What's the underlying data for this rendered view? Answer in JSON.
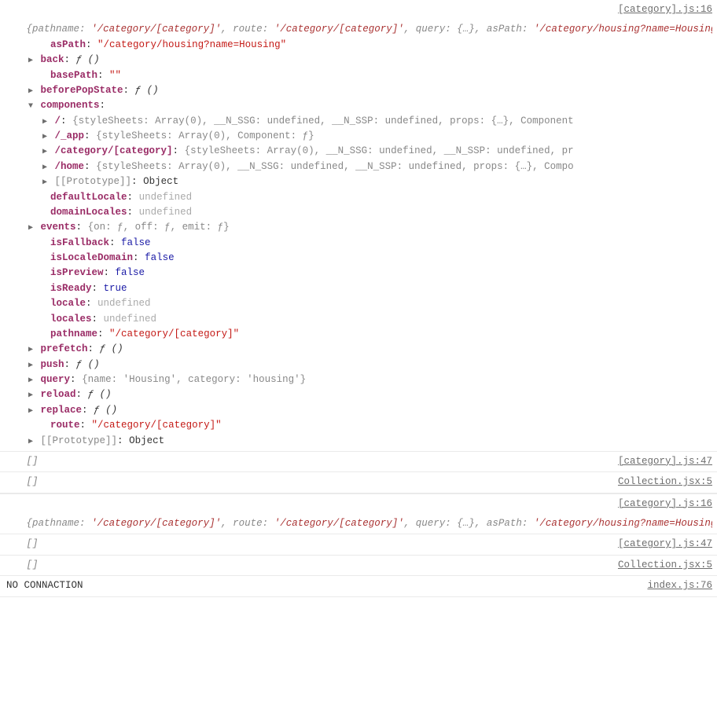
{
  "sources": {
    "cat16": "[category].js:16",
    "cat47": "[category].js:47",
    "coll5": "Collection.jsx:5",
    "idx76": "index.js:76"
  },
  "icons": {
    "info": "i"
  },
  "glyphs": {
    "emptyArr": "[]",
    "braceOpen": "{",
    "braceEllipsis": "{…}",
    "ellipsis": "…",
    "braceClose": "}",
    "colon": ":",
    "comma": ","
  },
  "preview": {
    "labels": {
      "pathname": "pathname",
      "route": "route",
      "query": "query",
      "asPath": "asPath",
      "components": "components"
    },
    "pathname": "'/category/[category]'",
    "route": "'/category/[category]'",
    "asPath": "'/category/housing?name=Housing'"
  },
  "router": {
    "asPath": {
      "k": "asPath",
      "v": "\"/category/housing?name=Housing\""
    },
    "back": {
      "k": "back",
      "v": "ƒ ()"
    },
    "basePath": {
      "k": "basePath",
      "v": "\"\""
    },
    "beforePopState": {
      "k": "beforePopState",
      "v": "ƒ ()"
    },
    "componentsKey": "components",
    "components": {
      "slash": {
        "k": "/",
        "rest": "{styleSheets: Array(0), __N_SSG: undefined, __N_SSP: undefined, props: {…}, Component"
      },
      "app": {
        "k": "/_app",
        "rest": "{styleSheets: Array(0), Component: ƒ}"
      },
      "cat": {
        "k": "/category/[category]",
        "rest": "{styleSheets: Array(0), __N_SSG: undefined, __N_SSP: undefined, pr"
      },
      "home": {
        "k": "/home",
        "rest": "{styleSheets: Array(0), __N_SSG: undefined, __N_SSP: undefined, props: {…}, Compo"
      },
      "proto": {
        "k": "[[Prototype]]",
        "v": "Object"
      }
    },
    "defaultLocale": {
      "k": "defaultLocale",
      "v": "undefined"
    },
    "domainLocales": {
      "k": "domainLocales",
      "v": "undefined"
    },
    "events": {
      "k": "events",
      "rest": "{on: ƒ, off: ƒ, emit: ƒ}"
    },
    "isFallback": {
      "k": "isFallback",
      "v": "false"
    },
    "isLocaleDomain": {
      "k": "isLocaleDomain",
      "v": "false"
    },
    "isPreview": {
      "k": "isPreview",
      "v": "false"
    },
    "isReady": {
      "k": "isReady",
      "v": "true"
    },
    "locale": {
      "k": "locale",
      "v": "undefined"
    },
    "locales": {
      "k": "locales",
      "v": "undefined"
    },
    "pathname": {
      "k": "pathname",
      "v": "\"/category/[category]\""
    },
    "prefetch": {
      "k": "prefetch",
      "v": "ƒ ()"
    },
    "push": {
      "k": "push",
      "v": "ƒ ()"
    },
    "query": {
      "k": "query",
      "rest": "{name: 'Housing', category: 'housing'}"
    },
    "reload": {
      "k": "reload",
      "v": "ƒ ()"
    },
    "replace": {
      "k": "replace",
      "v": "ƒ ()"
    },
    "route": {
      "k": "route",
      "v": "\"/category/[category]\""
    },
    "proto": {
      "k": "[[Prototype]]",
      "v": "Object"
    }
  },
  "msgs": {
    "noconn": "NO CONNACTION"
  }
}
